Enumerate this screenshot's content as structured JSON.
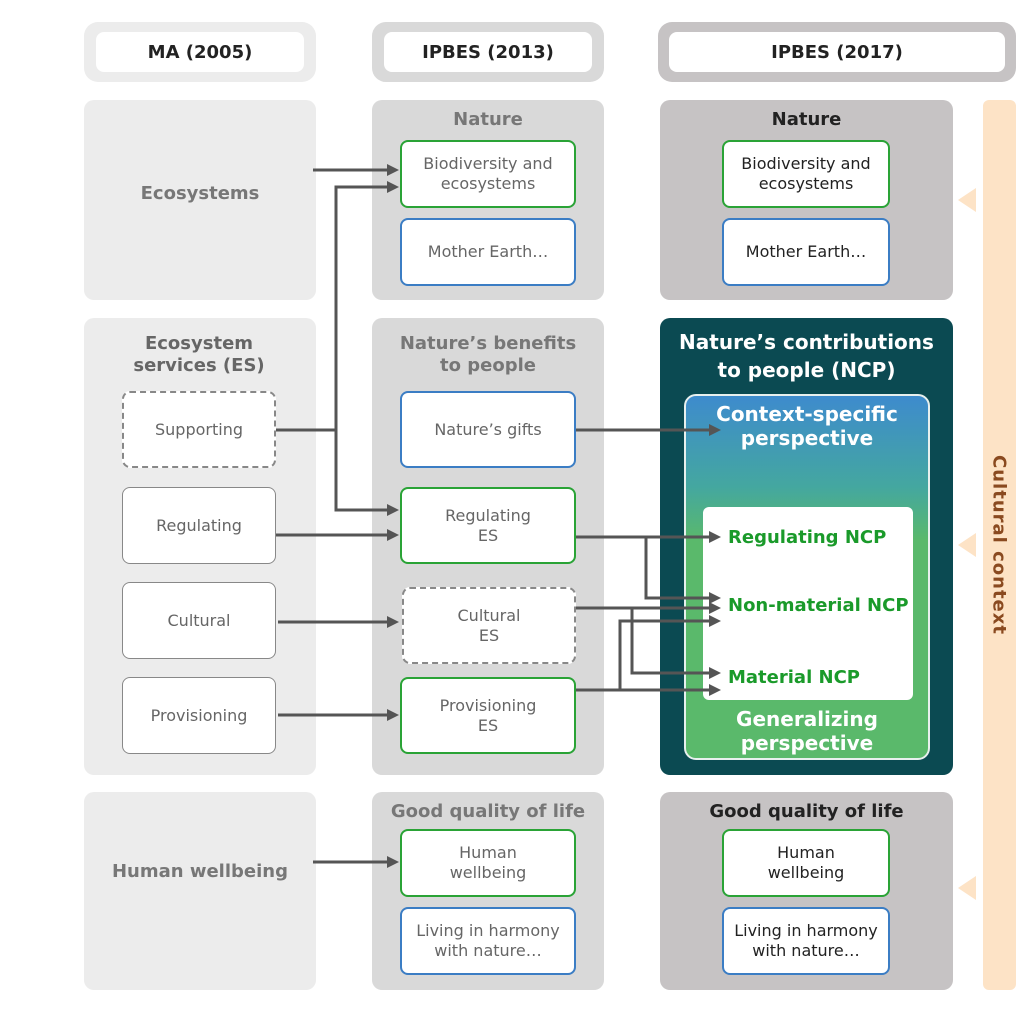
{
  "headers": [
    "MA (2005)",
    "IPBES (2013)",
    "IPBES (2017)"
  ],
  "ma": {
    "ecosystems": "Ecosystems",
    "es_title": "Ecosystem services (ES)",
    "supporting": "Supporting",
    "regulating": "Regulating",
    "cultural": "Cultural",
    "provisioning": "Provisioning",
    "wellbeing": "Human wellbeing"
  },
  "ipbes2013": {
    "nature": "Nature",
    "bio": "Biodiversity and ecosystems",
    "mother": "Mother Earth…",
    "benefits": "Nature’s benefits to people",
    "gifts": "Nature’s gifts",
    "reg": "Regulating ES",
    "cult": "Cultural ES",
    "prov": "Provisioning ES",
    "gql": "Good quality of life",
    "hw": "Human wellbeing",
    "harmony": "Living in harmony with nature…"
  },
  "ipbes2017": {
    "nature": "Nature",
    "bio": "Biodiversity and ecosystems",
    "mother": "Mother Earth…",
    "ncp_title": "Nature’s contributions to people (NCP)",
    "context": "Context-specific perspective",
    "reg": "Regulating NCP",
    "nonmat": "Non-material NCP",
    "mat": "Material NCP",
    "general": "Generalizing perspective",
    "gql": "Good quality of life",
    "hw": "Human wellbeing",
    "harmony": "Living in harmony with nature…"
  },
  "cultural_context": "Cultural context",
  "colors": {
    "green": "#2aa336",
    "blue": "#3b7dc4",
    "ncp_panel": "#0b4a52",
    "context": "#fde3c6"
  }
}
